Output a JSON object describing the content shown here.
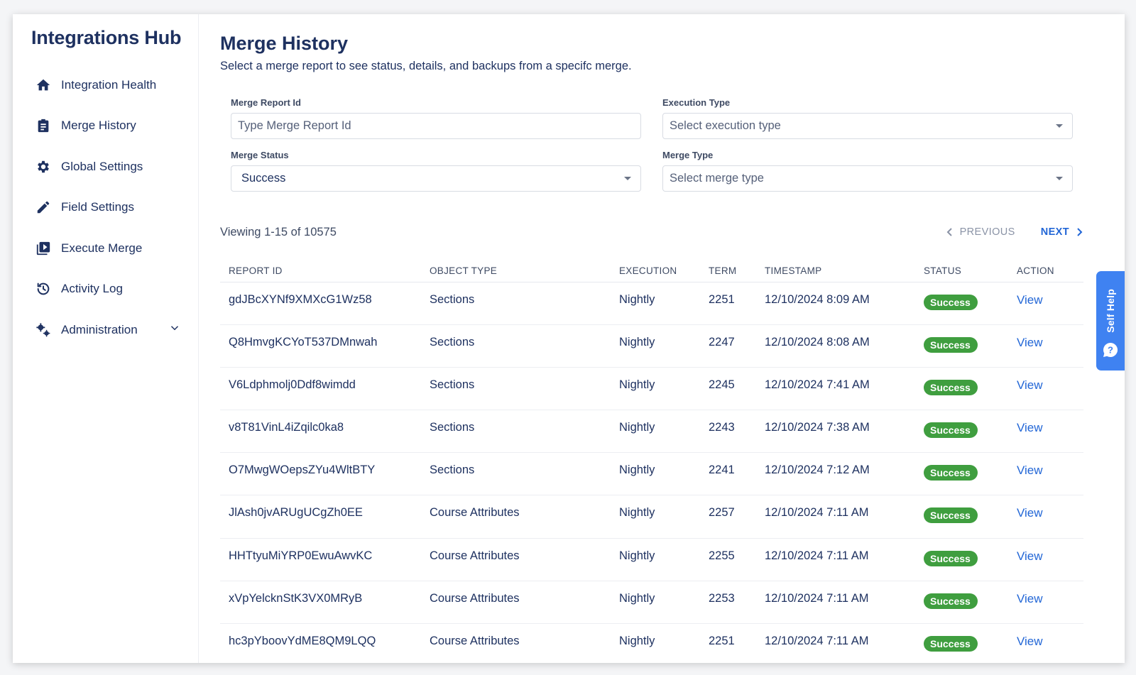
{
  "sidebar": {
    "app_title": "Integrations Hub",
    "items": [
      {
        "label": "Integration Health",
        "icon": "home-icon"
      },
      {
        "label": "Merge History",
        "icon": "clipboard-icon"
      },
      {
        "label": "Global Settings",
        "icon": "gear-icon"
      },
      {
        "label": "Field Settings",
        "icon": "pencil-icon"
      },
      {
        "label": "Execute Merge",
        "icon": "play-library-icon"
      },
      {
        "label": "Activity Log",
        "icon": "history-icon"
      },
      {
        "label": "Administration",
        "icon": "gears-icon"
      }
    ]
  },
  "main": {
    "title": "Merge History",
    "subtitle": "Select a merge report to see status, details, and backups from a specifc merge."
  },
  "filters": {
    "report_id_label": "Merge Report Id",
    "report_id_placeholder": "Type Merge Report Id",
    "execution_type_label": "Execution Type",
    "execution_type_placeholder": "Select execution type",
    "merge_status_label": "Merge Status",
    "merge_status_value": "Success",
    "merge_type_label": "Merge Type",
    "merge_type_placeholder": "Select merge type"
  },
  "pagination": {
    "viewing_text": "Viewing 1-15 of 10575",
    "previous_label": "PREVIOUS",
    "next_label": "NEXT"
  },
  "table": {
    "columns": [
      "REPORT ID",
      "OBJECT TYPE",
      "EXECUTION",
      "TERM",
      "TIMESTAMP",
      "STATUS",
      "ACTION"
    ],
    "rows": [
      {
        "report_id": "gdJBcXYNf9XMXcG1Wz58",
        "object_type": "Sections",
        "execution": "Nightly",
        "term": "2251",
        "timestamp": "12/10/2024 8:09 AM",
        "status": "Success",
        "action": "View"
      },
      {
        "report_id": "Q8HmvgKCYoT537DMnwah",
        "object_type": "Sections",
        "execution": "Nightly",
        "term": "2247",
        "timestamp": "12/10/2024 8:08 AM",
        "status": "Success",
        "action": "View"
      },
      {
        "report_id": "V6Ldphmolj0Ddf8wimdd",
        "object_type": "Sections",
        "execution": "Nightly",
        "term": "2245",
        "timestamp": "12/10/2024 7:41 AM",
        "status": "Success",
        "action": "View"
      },
      {
        "report_id": "v8T81VinL4iZqilc0ka8",
        "object_type": "Sections",
        "execution": "Nightly",
        "term": "2243",
        "timestamp": "12/10/2024 7:38 AM",
        "status": "Success",
        "action": "View"
      },
      {
        "report_id": "O7MwgWOepsZYu4WltBTY",
        "object_type": "Sections",
        "execution": "Nightly",
        "term": "2241",
        "timestamp": "12/10/2024 7:12 AM",
        "status": "Success",
        "action": "View"
      },
      {
        "report_id": "JlAsh0jvARUgUCgZh0EE",
        "object_type": "Course Attributes",
        "execution": "Nightly",
        "term": "2257",
        "timestamp": "12/10/2024 7:11 AM",
        "status": "Success",
        "action": "View"
      },
      {
        "report_id": "HHTtyuMiYRP0EwuAwvKC",
        "object_type": "Course Attributes",
        "execution": "Nightly",
        "term": "2255",
        "timestamp": "12/10/2024 7:11 AM",
        "status": "Success",
        "action": "View"
      },
      {
        "report_id": "xVpYelcknStK3VX0MRyB",
        "object_type": "Course Attributes",
        "execution": "Nightly",
        "term": "2253",
        "timestamp": "12/10/2024 7:11 AM",
        "status": "Success",
        "action": "View"
      },
      {
        "report_id": "hc3pYboovYdME8QM9LQQ",
        "object_type": "Course Attributes",
        "execution": "Nightly",
        "term": "2251",
        "timestamp": "12/10/2024 7:11 AM",
        "status": "Success",
        "action": "View"
      }
    ]
  },
  "self_help": {
    "label": "Self Help",
    "icon": "question-bubble-icon"
  },
  "colors": {
    "brand_navy": "#1e3160",
    "link_blue": "#2266d6",
    "success_green": "#3f9e3f",
    "self_help_blue": "#3f82f1"
  }
}
